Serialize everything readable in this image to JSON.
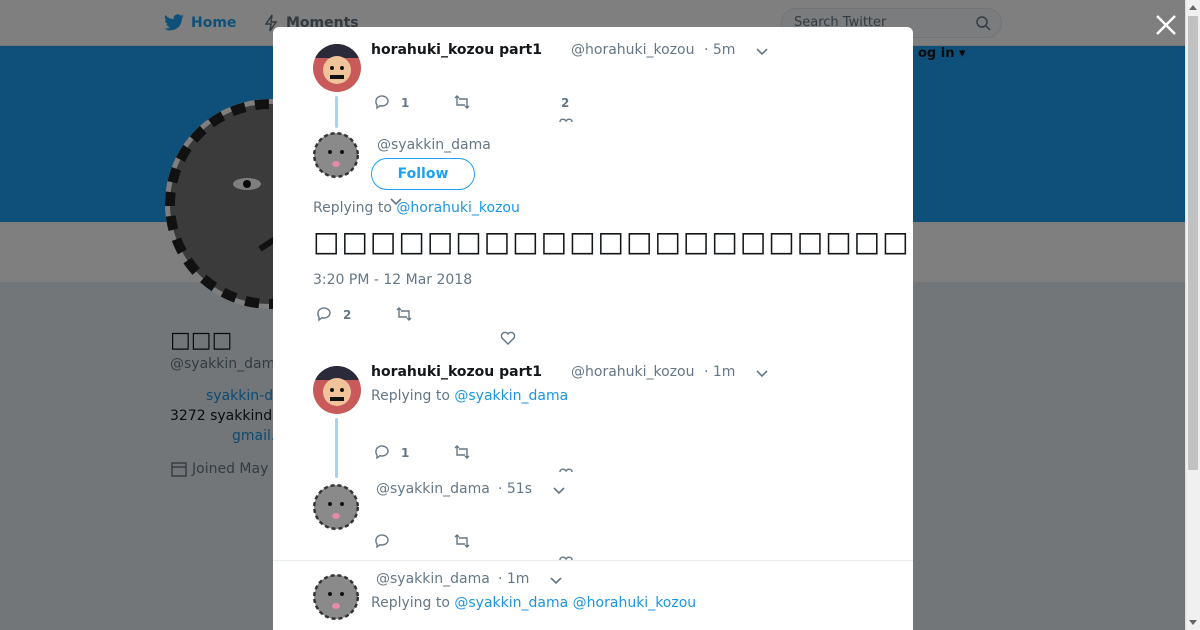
{
  "nav": {
    "home_label": "Home",
    "moments_label": "Moments",
    "search_placeholder": "Search Twitter",
    "login_label": "og in ▾"
  },
  "profile": {
    "name": "□□□",
    "handle": "@syakkin_dam",
    "link1": "syakkin-d",
    "location": "3272 syakkind",
    "link2": "gmail.",
    "joined": "Joined May"
  },
  "modal": {
    "tweet1": {
      "name": "horahuki_kozou part1",
      "handle": "@horahuki_kozou",
      "time": "· 5m",
      "replies": "1",
      "likes": "2"
    },
    "main": {
      "handle": "@syakkin_dama",
      "follow_label": "Follow",
      "replying_prefix": "Replying to",
      "replying_to": "@horahuki_kozou",
      "text": "□□□□□□□□□□□□□□□□□□□□□□□□□□□□□□□□□□□",
      "timestamp": "3:20 PM - 12 Mar 2018",
      "replies": "2"
    },
    "reply1": {
      "name": "horahuki_kozou part1",
      "handle": "@horahuki_kozou",
      "time": "· 1m",
      "replying_prefix": "Replying to",
      "replying_to": "@syakkin_dama",
      "replies": "1"
    },
    "reply2": {
      "handle": "@syakkin_dama",
      "time": "· 51s"
    },
    "reply3": {
      "handle": "@syakkin_dama",
      "time": "· 1m",
      "replying_prefix": "Replying to",
      "replying_to_1": "@syakkin_dama",
      "replying_to_2": "@horahuki_kozou"
    }
  },
  "colors": {
    "accent": "#1da1f2",
    "link": "#1b95e0",
    "muted": "#657786",
    "thread_line": "#a6d4f2"
  }
}
